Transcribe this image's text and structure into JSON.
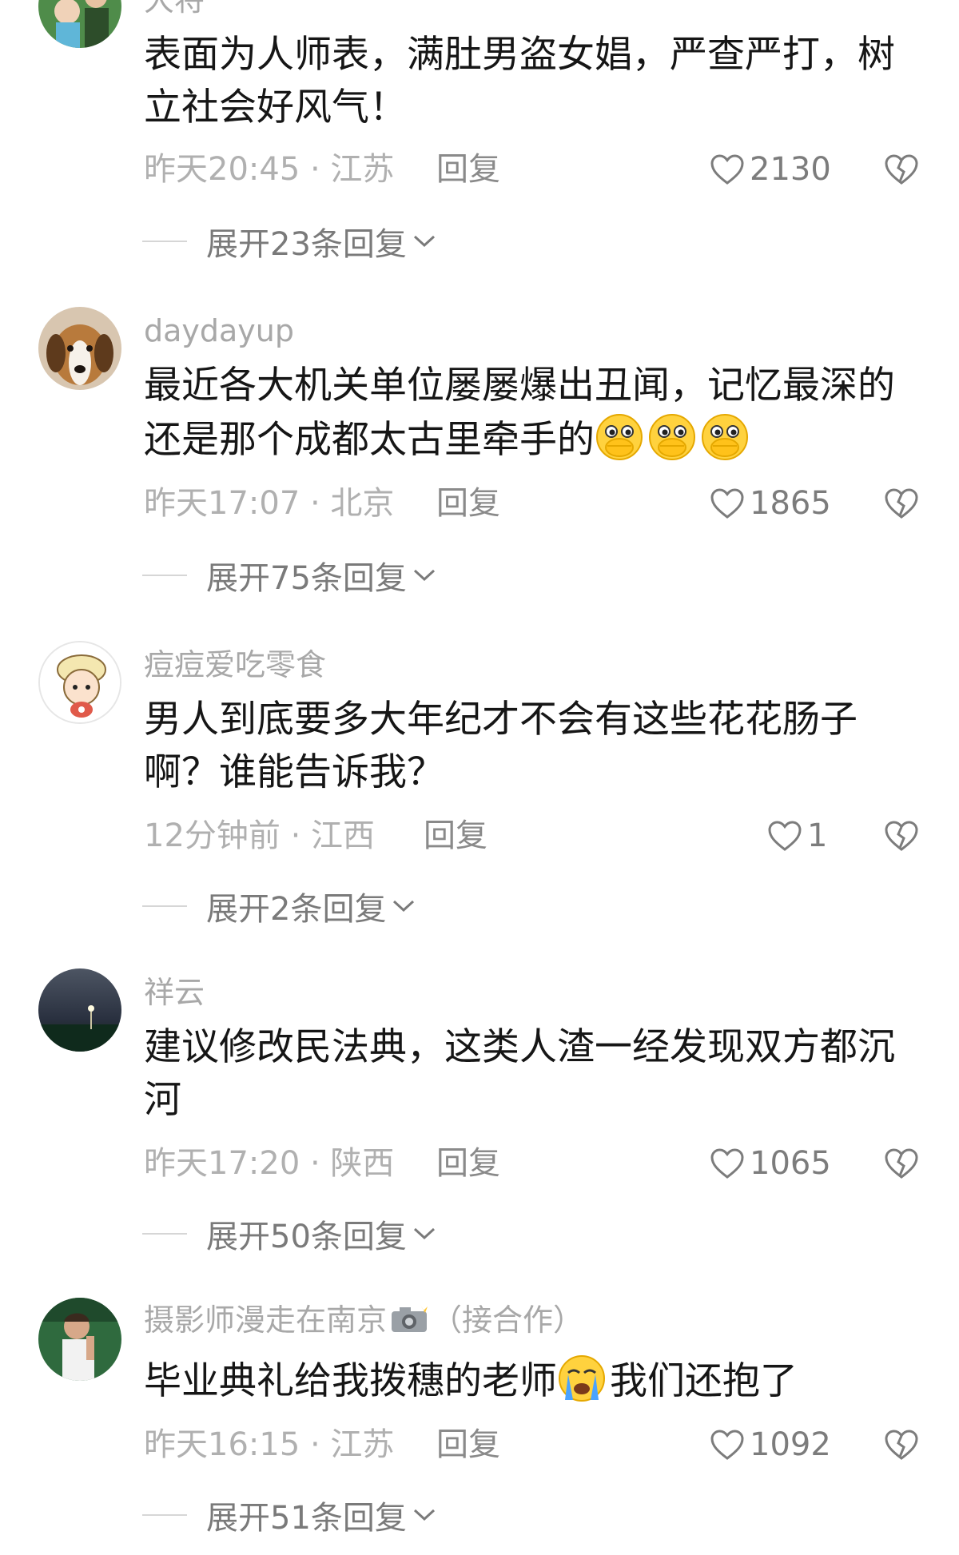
{
  "comments": [
    {
      "username": "大将",
      "text": "表面为人师表，满肚男盗女娼，严查严打，树立社会好风气！",
      "meta": "昨天20:45 · 江苏",
      "reply_label": "回复",
      "likes": "2130",
      "expand_label": "展开23条回复"
    },
    {
      "username": "daydayup",
      "text": "最近各大机关单位屡屡爆出丑闻，记忆最深的还是那个成都太古里牵手的",
      "emojis": [
        "hand-over-mouth",
        "hand-over-mouth",
        "hand-over-mouth"
      ],
      "meta": "昨天17:07 · 北京",
      "reply_label": "回复",
      "likes": "1865",
      "expand_label": "展开75条回复"
    },
    {
      "username": "痘痘爱吃零食",
      "text": "男人到底要多大年纪才不会有这些花花肠子啊？谁能告诉我？",
      "meta": "12分钟前 · 江西",
      "reply_label": "回复",
      "likes": "1",
      "expand_label": "展开2条回复"
    },
    {
      "username": "祥云",
      "text": "建议修改民法典，这类人渣一经发现双方都沉河",
      "meta": "昨天17:20 · 陕西",
      "reply_label": "回复",
      "likes": "1065",
      "expand_label": "展开50条回复"
    },
    {
      "username_part1": "摄影师漫走在南京",
      "username_part2": "（接合作）",
      "username_emoji": "camera-flash",
      "text_part1": "毕业典礼给我拨穗的老师",
      "text_emoji": "crying-face",
      "text_part2": "我们还抱了",
      "meta": "昨天16:15 · 江苏",
      "reply_label": "回复",
      "likes": "1092",
      "expand_label": "展开51条回复"
    }
  ],
  "colors": {
    "text": "#161616",
    "muted": "#b0b0b0",
    "reply": "#8a8a8a",
    "like": "#7c7c7c"
  },
  "icons": {
    "like": "heart-outline-icon",
    "dislike": "broken-heart-icon",
    "expand": "chevron-down-icon"
  }
}
